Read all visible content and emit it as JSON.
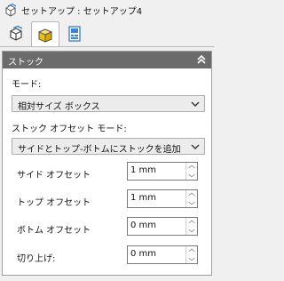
{
  "window": {
    "title": "セットアップ : セットアップ4"
  },
  "tabs": [
    {
      "icon": "setup-cube-outline-icon",
      "active": false
    },
    {
      "icon": "stock-box-yellow-icon",
      "active": true
    },
    {
      "icon": "post-process-document-icon",
      "active": false
    }
  ],
  "panel": {
    "title": "ストック",
    "collapse_icon": "double-chevron-up-icon",
    "mode_label": "モード:",
    "mode_value": "相対サイズ ボックス",
    "offset_mode_label": "ストック オフセット モード:",
    "offset_mode_value": "サイドとトップ-ボトムにストックを追加",
    "fields": [
      {
        "label": "サイド オフセット",
        "value": "1 mm"
      },
      {
        "label": "トップ オフセット",
        "value": "1 mm"
      },
      {
        "label": "ボトム オフセット",
        "value": "0 mm"
      },
      {
        "label": "切り上げ:",
        "value": "0 mm"
      }
    ]
  },
  "colors": {
    "panel_header": "#6b6b6b",
    "background": "#f0f0f0",
    "stock_icon_yellow": "#f2c200"
  }
}
